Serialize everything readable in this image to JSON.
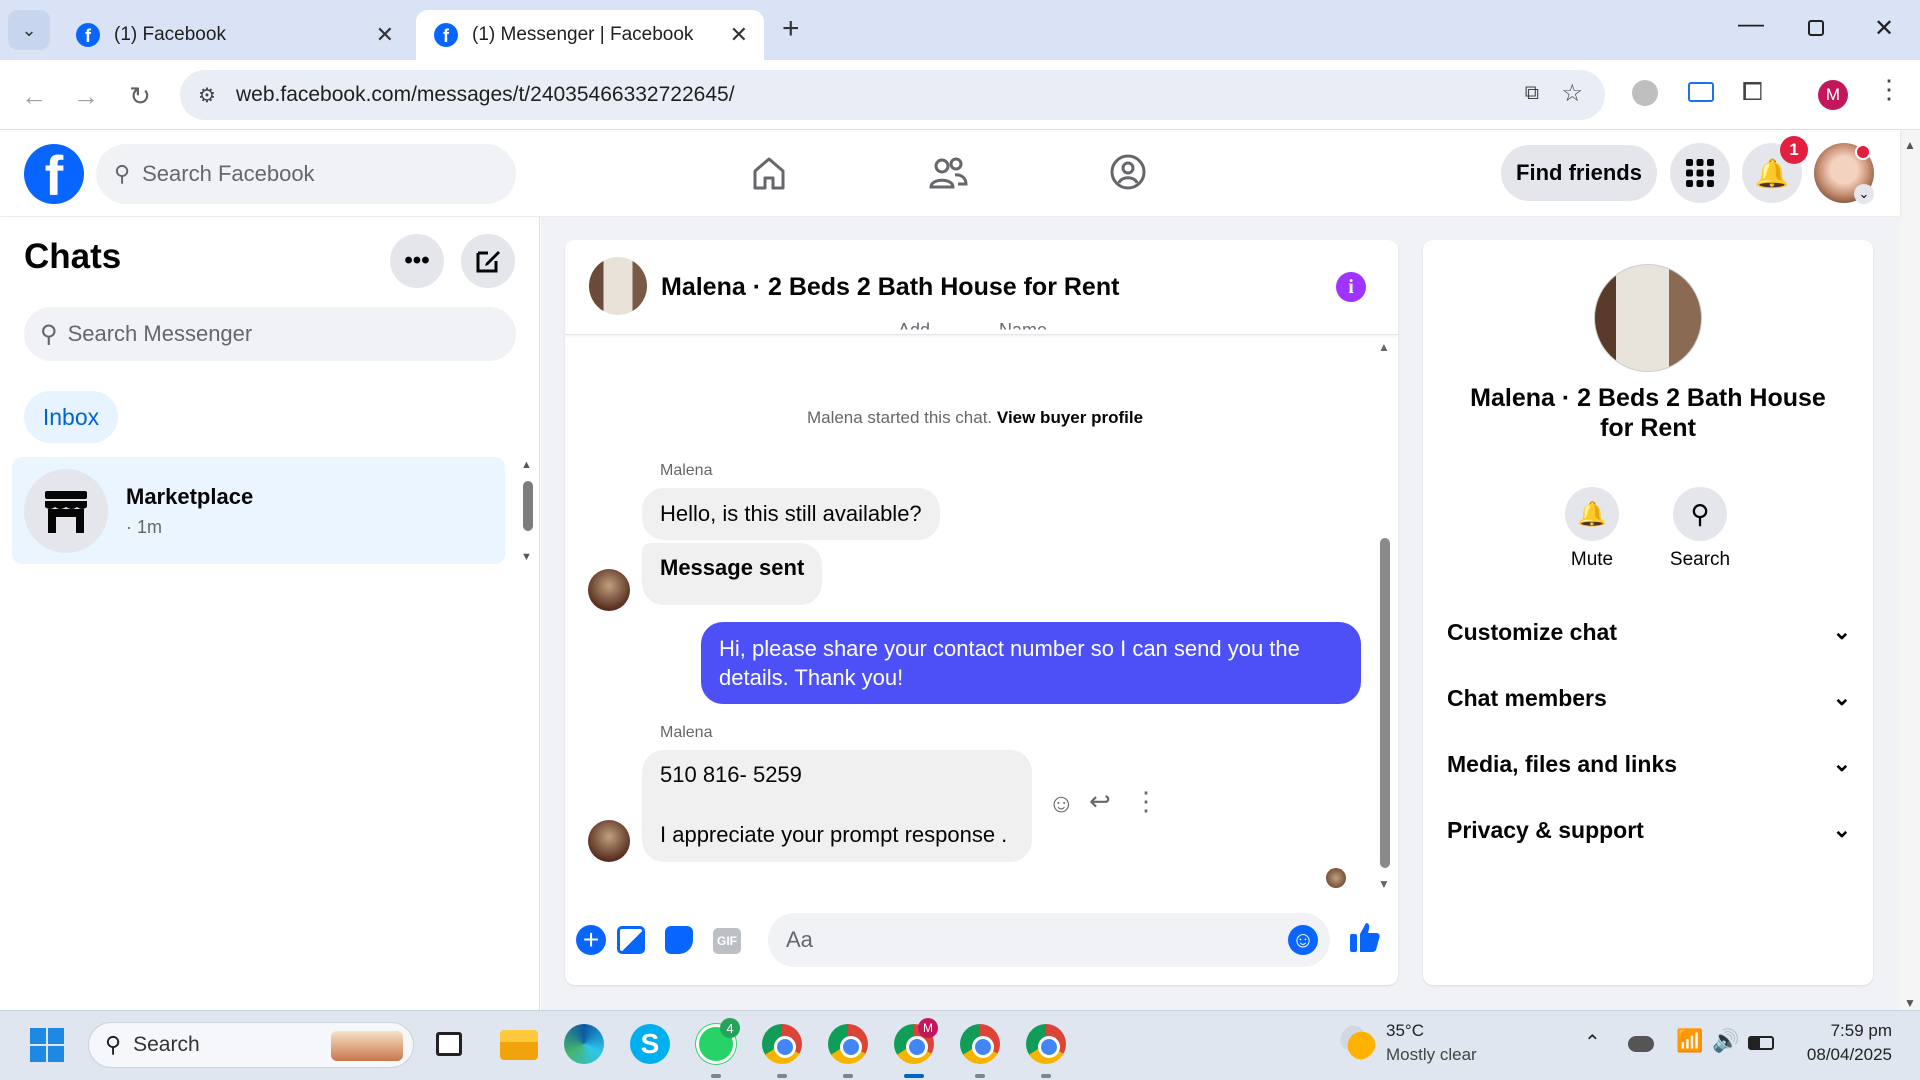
{
  "browser": {
    "tabs": [
      {
        "title": "(1) Facebook",
        "active": false
      },
      {
        "title": "(1) Messenger | Facebook",
        "active": true
      }
    ],
    "url": "web.facebook.com/messages/t/24035466332722645/",
    "profile_initial": "M",
    "window_controls": [
      "minimize-icon",
      "restore-icon",
      "close-icon"
    ]
  },
  "fb_header": {
    "search_placeholder": "Search Facebook",
    "find_friends_label": "Find friends",
    "notification_count": "1"
  },
  "chats": {
    "title": "Chats",
    "search_placeholder": "Search Messenger",
    "filter_label": "Inbox",
    "items": [
      {
        "name": "Marketplace",
        "meta": "· 1m"
      }
    ]
  },
  "conversation": {
    "title": "Malena · 2 Beds 2 Bath House for Rent",
    "cut_off_labels": [
      "Add",
      "Name"
    ],
    "system_text": "Malena started this chat.",
    "system_link": "View buyer profile",
    "messages": [
      {
        "sender": "Malena",
        "text": "Hello, is this still available?"
      },
      {
        "sender": "",
        "text": "Message sent"
      },
      {
        "sender": "me",
        "text": "Hi, please share your contact number so I can send you the details. Thank you!"
      },
      {
        "sender": "Malena",
        "line1": "510 816- 5259",
        "line2": "I appreciate your prompt response ."
      }
    ],
    "composer_placeholder": "Aa",
    "accent_color": "#4c50f6"
  },
  "info_panel": {
    "title": "Malena · 2 Beds 2 Bath House for Rent",
    "actions": [
      {
        "label": "Mute",
        "icon": "bell-icon"
      },
      {
        "label": "Search",
        "icon": "search-icon"
      }
    ],
    "sections": [
      "Customize chat",
      "Chat members",
      "Media, files and links",
      "Privacy & support"
    ]
  },
  "taskbar": {
    "search_placeholder": "Search",
    "weather_temp": "35°C",
    "weather_desc": "Mostly clear",
    "time": "7:59 pm",
    "date": "08/04/2025",
    "whatsapp_badge": "4"
  }
}
